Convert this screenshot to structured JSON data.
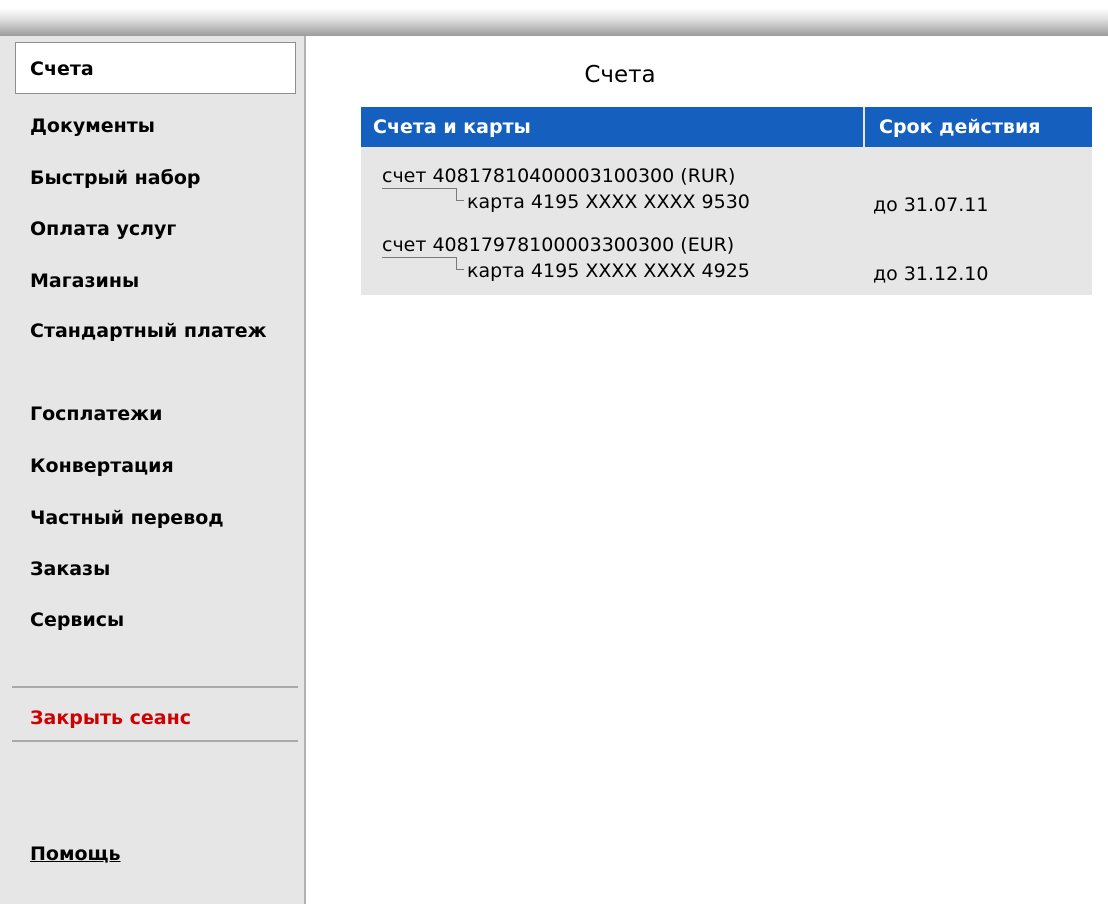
{
  "sidebar": {
    "items": [
      {
        "label": "Счета",
        "active": true
      },
      {
        "label": "Документы"
      },
      {
        "label": "Быстрый набор"
      },
      {
        "label": "Оплата услуг"
      },
      {
        "label": "Магазины"
      },
      {
        "label": "Стандартный платеж"
      },
      {
        "label": "Госплатежи"
      },
      {
        "label": "Конвертация"
      },
      {
        "label": "Частный перевод"
      },
      {
        "label": "Заказы"
      },
      {
        "label": "Сервисы"
      }
    ],
    "logout_label": "Закрыть сеанс",
    "help_label": "Помощь"
  },
  "main": {
    "title": "Счета",
    "table": {
      "headers": [
        "Счета и карты",
        "Срок действия"
      ],
      "rows": [
        {
          "account": "счет 40817810400003100300 (RUR)",
          "card": "карта 4195 XXXX XXXX 9530",
          "expiry": "до 31.07.11"
        },
        {
          "account": "счет 40817978100003300300 (EUR)",
          "card": "карта 4195 XXXX XXXX 4925",
          "expiry": "до 31.12.10"
        }
      ]
    }
  },
  "colors": {
    "header_bg": "#1560bf",
    "sidebar_bg": "#e6e6e6",
    "logout": "#d00000"
  }
}
